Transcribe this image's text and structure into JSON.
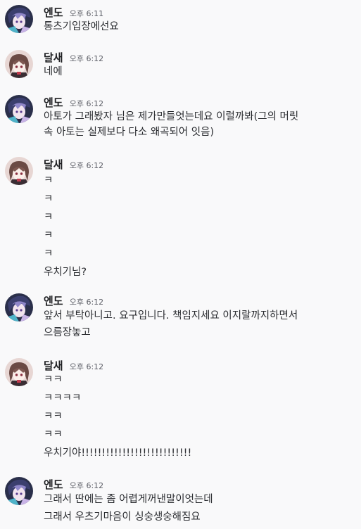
{
  "users": {
    "endo": {
      "name": "엔도",
      "avatar_icon": "endo-avatar-icon",
      "avatar_bg": "#2a2f4a",
      "avatar_accent": "#c8b3e6"
    },
    "dalsae": {
      "name": "달새",
      "avatar_icon": "dalsae-avatar-icon",
      "avatar_bg": "#e7d6d3",
      "avatar_accent": "#6b4a44"
    }
  },
  "messages": [
    {
      "user": "엔도",
      "time": "오후 6:11",
      "lines": [
        "통츠기입장에선요"
      ]
    },
    {
      "user": "달새",
      "time": "오후 6:12",
      "lines": [
        "네에"
      ]
    },
    {
      "user": "엔도",
      "time": "오후 6:12",
      "lines": [
        "아토가 그래봤자 님은 제가만들엇는데요 이럴까봐(그의 머릿",
        "속 아토는 실제보다 다소 왜곡되어 잇음)"
      ]
    },
    {
      "user": "달새",
      "time": "오후 6:12",
      "lines": [
        "ㅋ",
        "ㅋ",
        "ㅋ",
        "ㅋ",
        "ㅋ",
        "우치기님?"
      ]
    },
    {
      "user": "엔도",
      "time": "오후 6:12",
      "lines": [
        "앞서 부탁아니고. 요구입니다. 책임지세요 이지랄까지하면서",
        "으름장놓고"
      ]
    },
    {
      "user": "달새",
      "time": "오후 6:12",
      "lines": [
        "ㅋㅋ",
        "ㅋㅋㅋㅋ",
        "ㅋㅋ",
        "ㅋㅋ",
        "우치기야!!!!!!!!!!!!!!!!!!!!!!!!!!!"
      ]
    },
    {
      "user": "엔도",
      "time": "오후 6:12",
      "lines": [
        "그래서 딴에는 좀 어렵게꺼낸말이엇는데",
        "그래서 우츠기마음이 싱숭생숭해짐요"
      ]
    }
  ]
}
